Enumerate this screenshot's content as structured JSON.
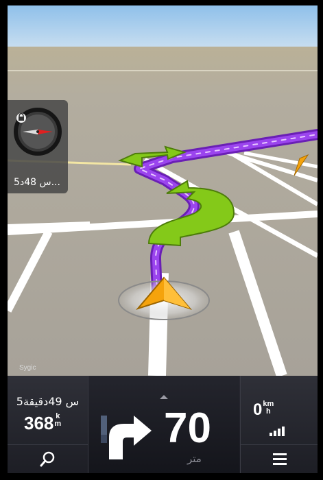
{
  "app": {
    "brand": "Sygic"
  },
  "map": {
    "compass": {
      "eta": "5س 48د..."
    },
    "colors": {
      "route": "#8a2be2",
      "turn_arrow": "#8bd313",
      "position": "#f5a30c",
      "sky": "#9ec8ee",
      "ground": "#a8a39a"
    }
  },
  "bottom_bar": {
    "remaining_time": "5س 49دقيقة",
    "remaining_distance": {
      "value": "368",
      "unit_top": "k",
      "unit_bottom": "m"
    },
    "next_turn": {
      "icon": "turn-right-icon",
      "distance": "70",
      "unit": "متر",
      "lane_progress": 0.3
    },
    "speed": {
      "value": "0",
      "unit_top": "km",
      "unit_bottom": "h"
    },
    "gps_signal_icon": "signal-bars-icon",
    "search_icon": "search-icon",
    "menu_icon": "menu-icon"
  }
}
